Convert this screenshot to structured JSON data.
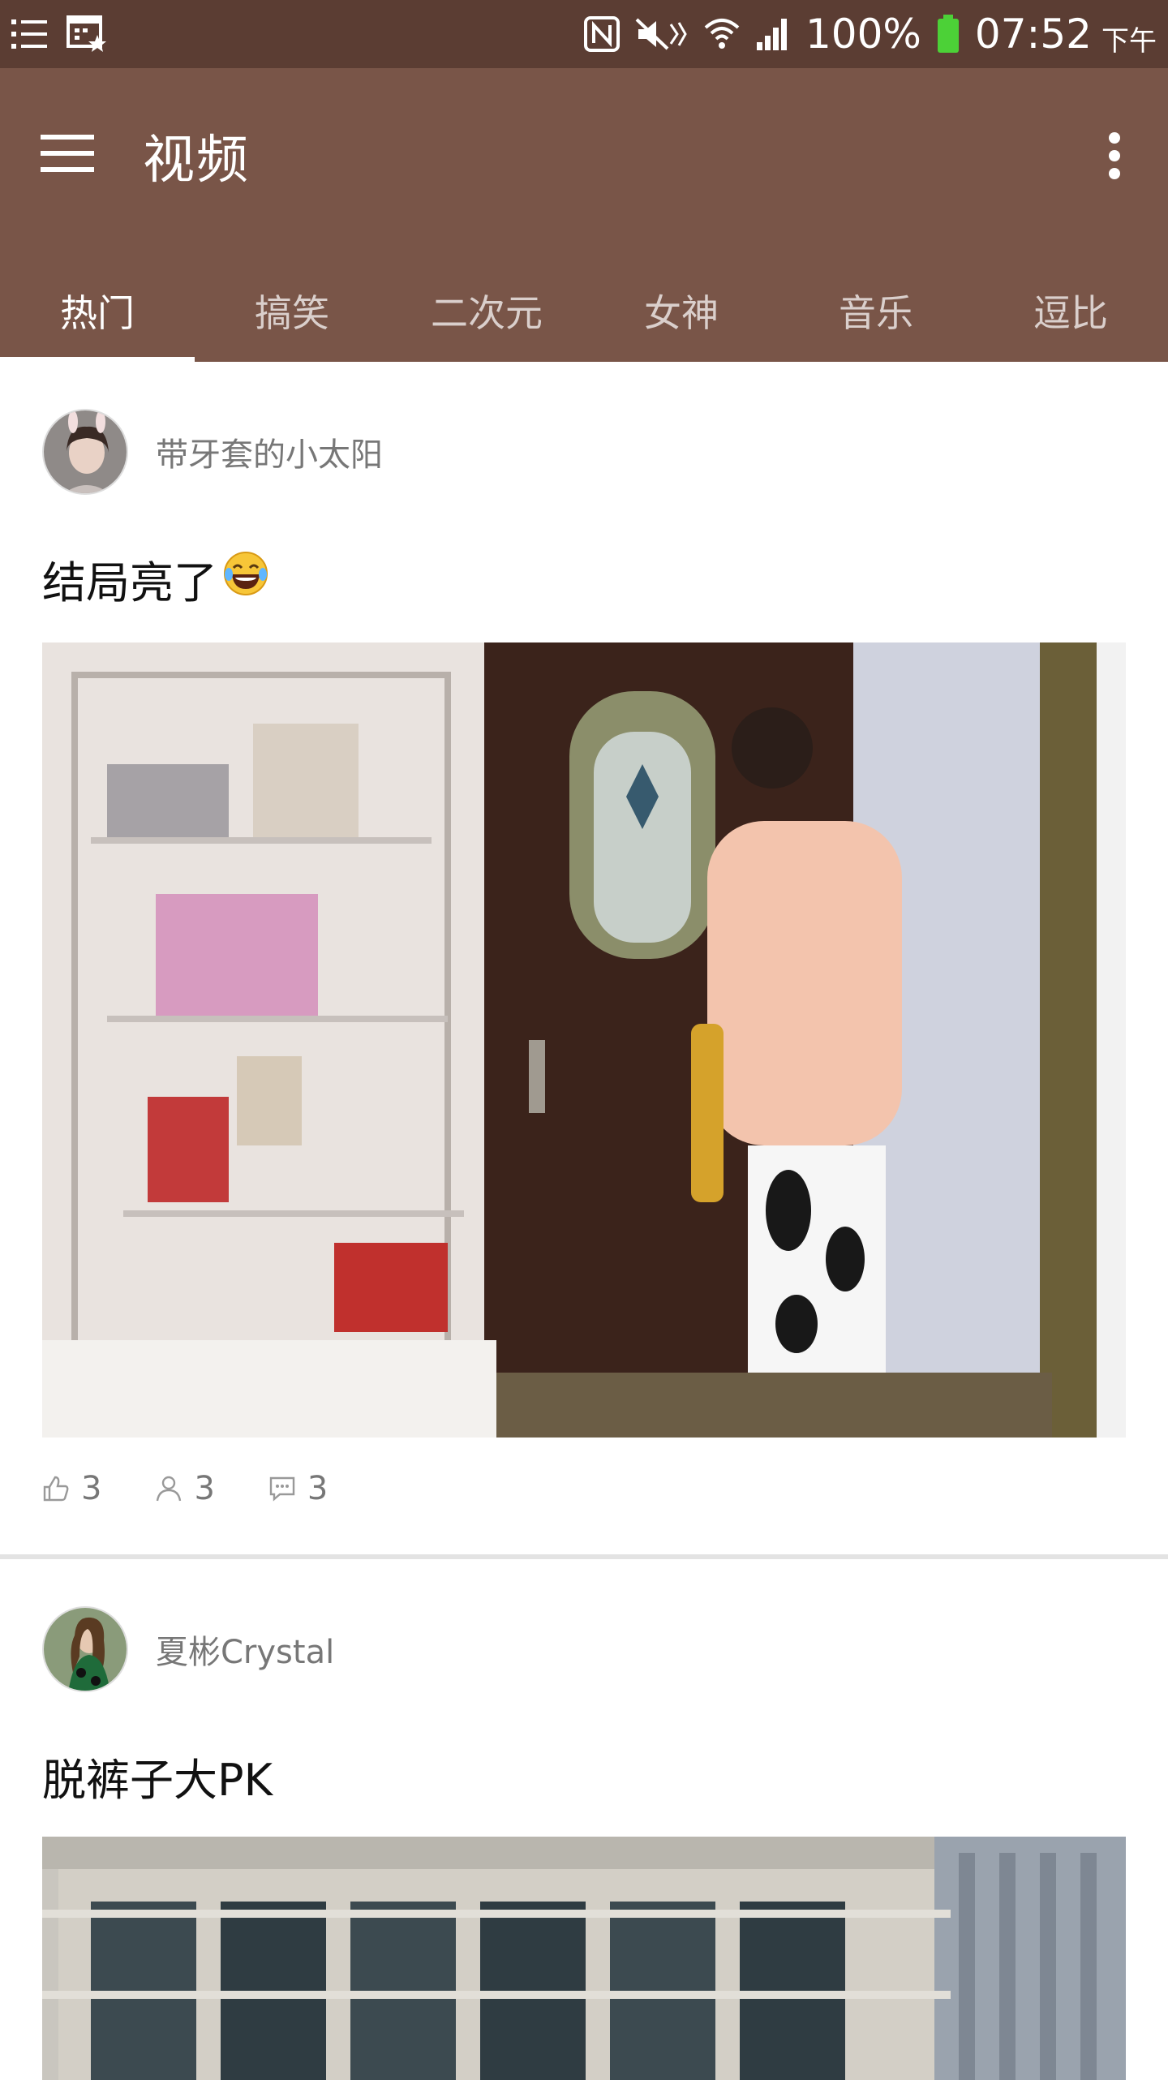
{
  "status_bar": {
    "battery": "100%",
    "time": "07:52",
    "period": "下午",
    "icons": [
      "list-icon",
      "calendar-icon",
      "nfc-icon",
      "mute-icon",
      "wifi-icon",
      "signal-icon",
      "battery-icon"
    ]
  },
  "app_bar": {
    "title": "视频",
    "icons": [
      "menu-icon",
      "more-vert-icon"
    ]
  },
  "tabs": [
    {
      "label": "热门",
      "active": true
    },
    {
      "label": "搞笑",
      "active": false
    },
    {
      "label": "二次元",
      "active": false
    },
    {
      "label": "女神",
      "active": false
    },
    {
      "label": "音乐",
      "active": false
    },
    {
      "label": "逗比",
      "active": false
    }
  ],
  "posts": [
    {
      "author": "带牙套的小太阳",
      "title": "结局亮了",
      "emoji": "laughing-tears-emoji",
      "likes": "3",
      "users": "3",
      "comments": "3"
    },
    {
      "author": "夏彬Crystal",
      "title": "脱裤子大PK"
    }
  ],
  "colors": {
    "status_bar": "#5b3d33",
    "app_bar": "#795548",
    "divider": "#e3e3e3"
  }
}
